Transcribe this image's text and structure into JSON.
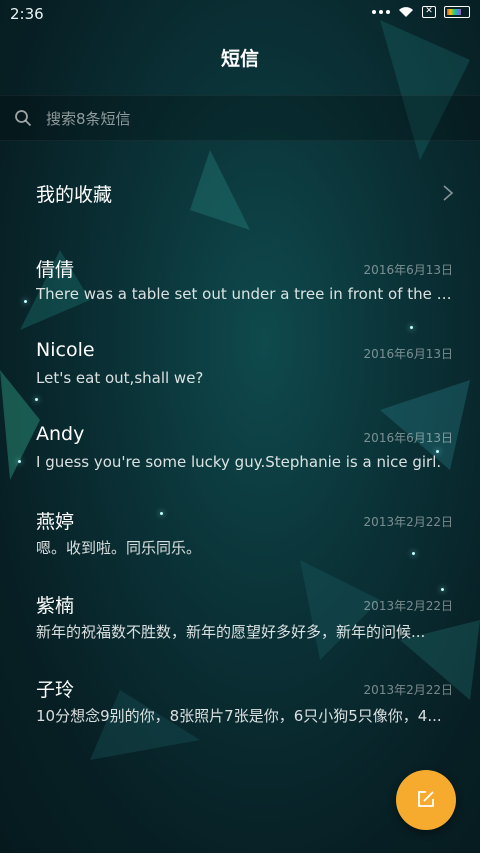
{
  "status": {
    "time": "2:36"
  },
  "header": {
    "title": "短信"
  },
  "search": {
    "placeholder": "搜索8条短信"
  },
  "favorites": {
    "label": "我的收藏"
  },
  "messages": [
    {
      "name": "倩倩",
      "date": "2016年6月13日",
      "preview": "There was a table set out under a tree in front of the ho..."
    },
    {
      "name": "Nicole",
      "date": "2016年6月13日",
      "preview": "Let's eat out,shall we?"
    },
    {
      "name": "Andy",
      "date": "2016年6月13日",
      "preview": "I guess you're some lucky guy.Stephanie is a nice girl."
    },
    {
      "name": "燕婷",
      "date": "2013年2月22日",
      "preview": "嗯。收到啦。同乐同乐。"
    },
    {
      "name": "紫楠",
      "date": "2013年2月22日",
      "preview": "新年的祝福数不胜数，新年的愿望好多好多，新年的问候..."
    },
    {
      "name": "子玲",
      "date": "2013年2月22日",
      "preview": "10分想念9别的你，8张照片7张是你，6只小狗5只像你，4..."
    }
  ],
  "colors": {
    "fab": "#f6ab2e",
    "background": "#0a3136"
  }
}
